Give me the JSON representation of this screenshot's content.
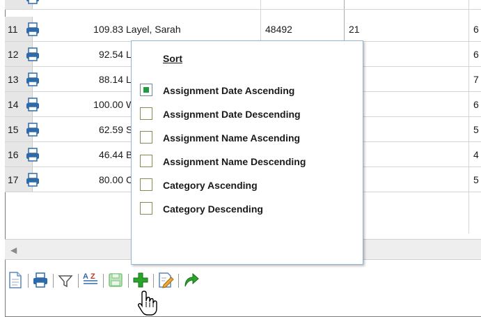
{
  "grid": {
    "rows": [
      {
        "num": "11",
        "score": "109.83",
        "name": "Layel, Sarah",
        "id": "48492",
        "value": "21",
        "last": "6"
      },
      {
        "num": "12",
        "score": "92.54",
        "name": "L",
        "id": "",
        "value": "",
        "last": "6"
      },
      {
        "num": "13",
        "score": "88.14",
        "name": "L",
        "id": "",
        "value": "",
        "last": "7"
      },
      {
        "num": "14",
        "score": "100.00",
        "name": "W",
        "id": "",
        "value": "",
        "last": "6"
      },
      {
        "num": "15",
        "score": "62.59",
        "name": "S",
        "id": "",
        "value": "",
        "last": "5"
      },
      {
        "num": "16",
        "score": "46.44",
        "name": "B",
        "id": "",
        "value": "",
        "last": "4"
      },
      {
        "num": "17",
        "score": "80.00",
        "name": "C",
        "id": "",
        "value": "",
        "last": "5"
      }
    ]
  },
  "sort_menu": {
    "title": "Sort",
    "options": [
      {
        "label": "Assignment Date Ascending",
        "selected": true
      },
      {
        "label": "Assignment Date Descending",
        "selected": false
      },
      {
        "label": "Assignment Name Ascending",
        "selected": false
      },
      {
        "label": "Assignment Name Descending",
        "selected": false
      },
      {
        "label": "Category Ascending",
        "selected": false
      },
      {
        "label": "Category Descending",
        "selected": false
      }
    ]
  },
  "toolbar": {
    "icons": [
      "document-icon",
      "print-icon",
      "filter-icon",
      "sort-az-icon",
      "save-icon",
      "add-icon",
      "edit-icon",
      "forward-arrow-icon"
    ]
  },
  "colors": {
    "selected_dot": "#1f9a3e",
    "popup_border": "#8fb5d8",
    "add_green": "#2aa52a"
  }
}
